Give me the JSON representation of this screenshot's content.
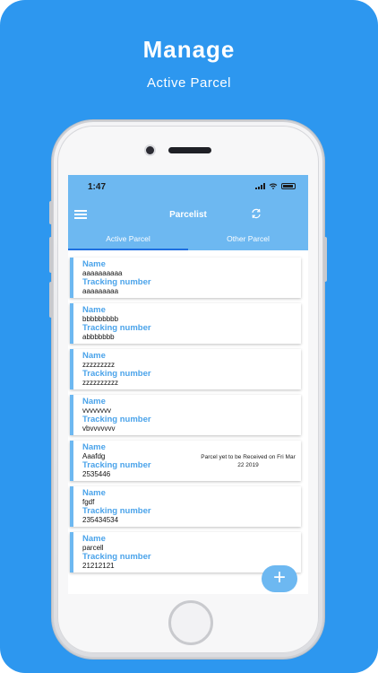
{
  "promo": {
    "headline": "Manage",
    "subline": "Active Parcel",
    "background": "#2D97EF"
  },
  "status_bar": {
    "time": "1:47"
  },
  "header": {
    "title": "Parcelist",
    "menu_icon": "menu-icon",
    "refresh_icon": "refresh-icon"
  },
  "tabs": [
    {
      "label": "Active Parcel",
      "active": true
    },
    {
      "label": "Other Parcel",
      "active": false
    }
  ],
  "parcels": [
    {
      "name_label": "Name",
      "name": "aaaaaaaaaa",
      "tracking_label": "Tracking number",
      "tracking": "aaaaaaaaa",
      "note": ""
    },
    {
      "name_label": "Name",
      "name": "bbbbbbbbb",
      "tracking_label": "Tracking number",
      "tracking": "abbbbbbb",
      "note": ""
    },
    {
      "name_label": "Name",
      "name": "zzzzzzzzz",
      "tracking_label": "Tracking number",
      "tracking": "zzzzzzzzzz",
      "note": ""
    },
    {
      "name_label": "Name",
      "name": "vvvvvvvv",
      "tracking_label": "Tracking number",
      "tracking": "vbvvvvvvv",
      "note": ""
    },
    {
      "name_label": "Name",
      "name": "Aaafdg",
      "tracking_label": "Tracking number",
      "tracking": "2535446",
      "note": "Parcel yet to be Received on Fri Mar 22 2019"
    },
    {
      "name_label": "Name",
      "name": "fgdf",
      "tracking_label": "Tracking number",
      "tracking": "235434534",
      "note": ""
    },
    {
      "name_label": "Name",
      "name": "parcell",
      "tracking_label": "Tracking number",
      "tracking": "21212121",
      "note": ""
    }
  ],
  "fab": {
    "label": "+",
    "icon": "plus-icon"
  },
  "colors": {
    "accent": "#6DB8F1",
    "label": "#4aa3ea"
  }
}
